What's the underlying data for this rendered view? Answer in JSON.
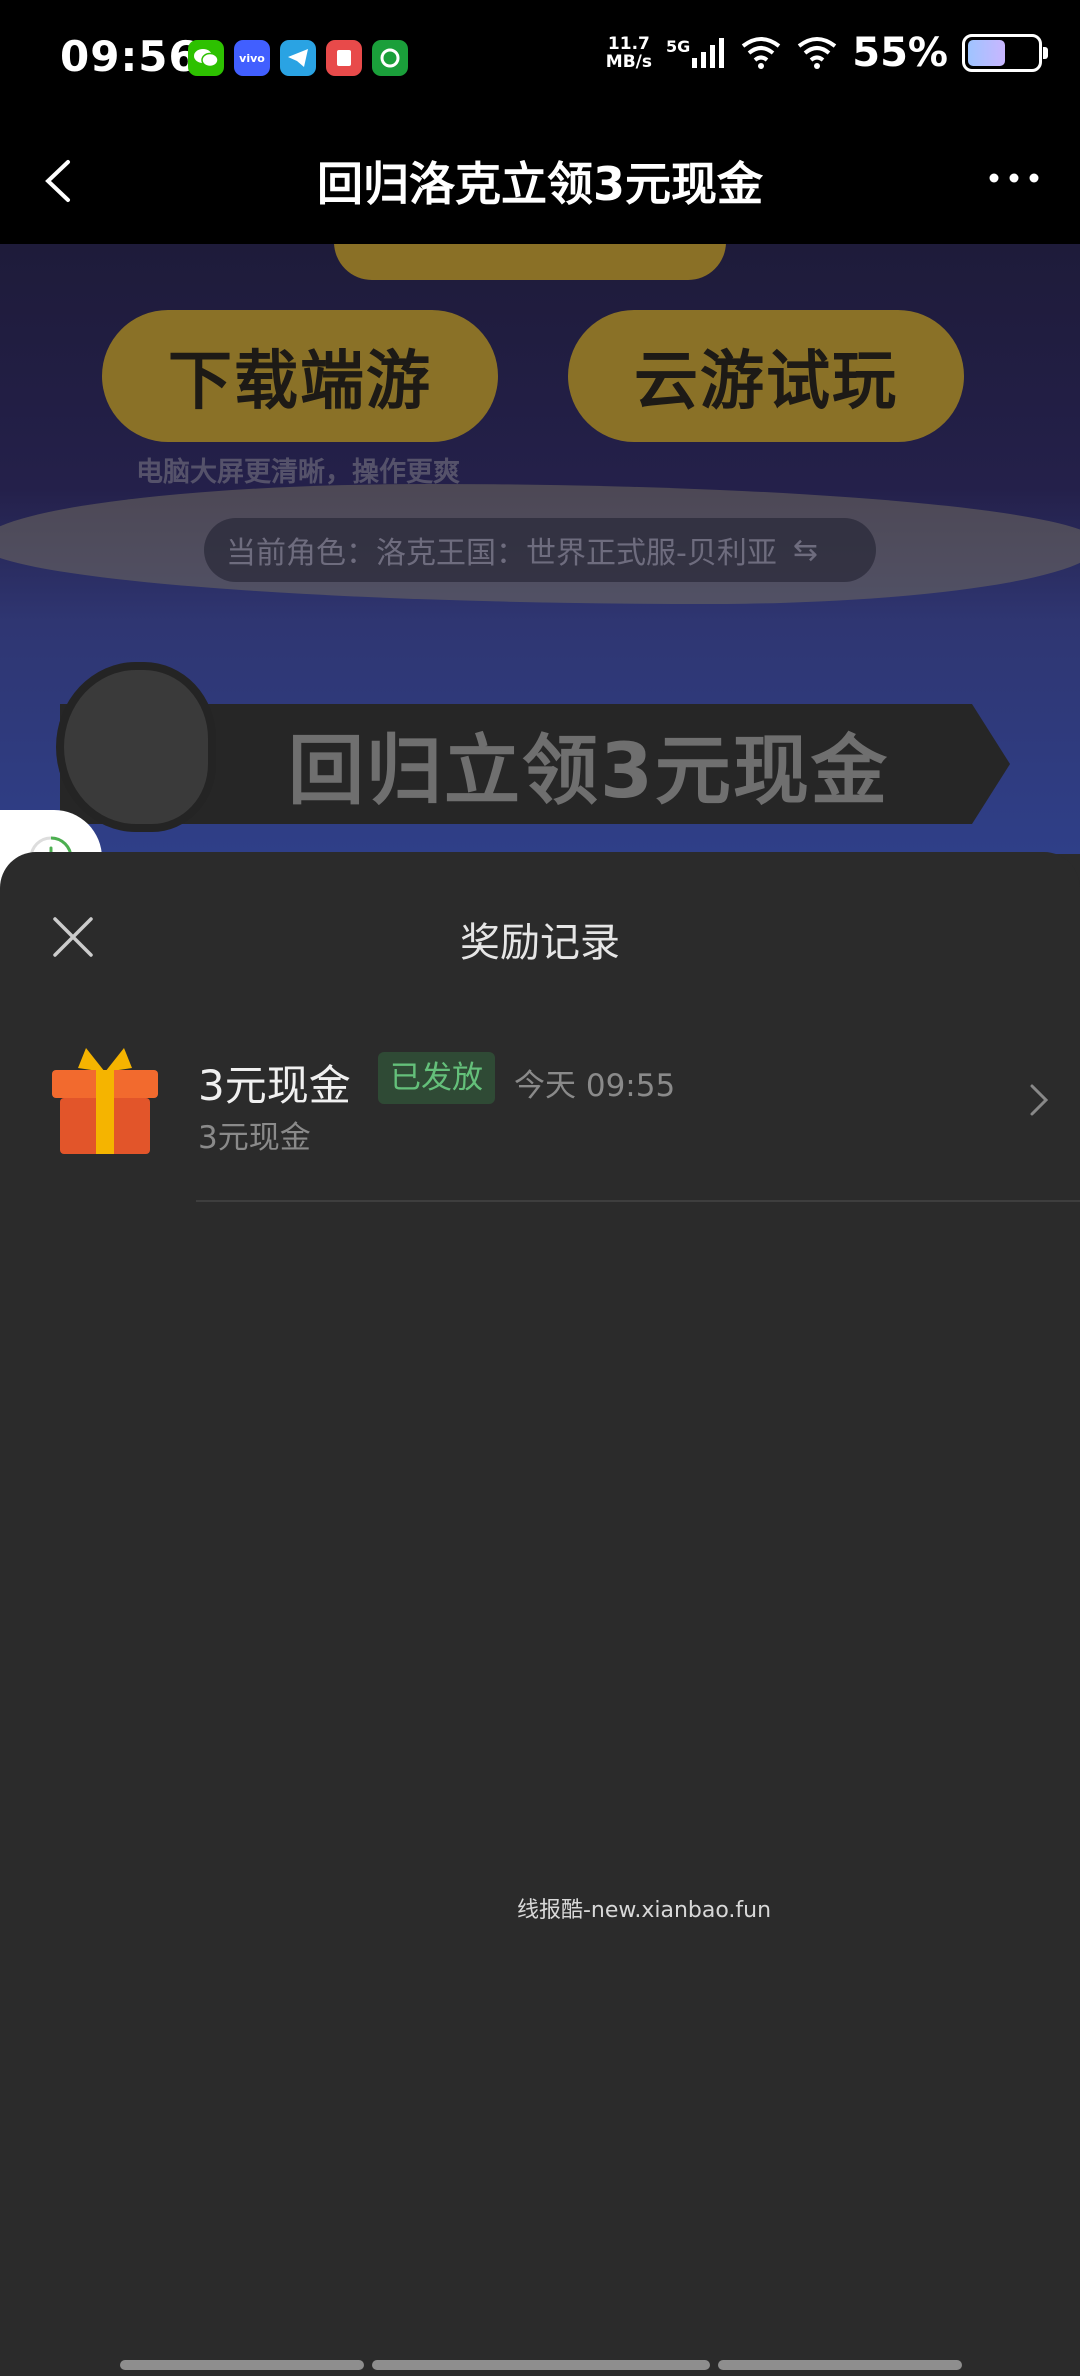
{
  "status_bar": {
    "time": "09:56",
    "net_speed_value": "11.7",
    "net_speed_unit": "MB/s",
    "network": "5G",
    "battery_percent": "55%",
    "battery_level": 0.55,
    "app_icons": [
      "wechat-icon",
      "vivo-icon",
      "telegram-icon",
      "notes-icon",
      "game-app-icon"
    ]
  },
  "header": {
    "title": "回归洛克立领3元现金"
  },
  "background_page": {
    "download_button": "下载端游",
    "cloud_button": "云游试玩",
    "hint": "电脑大屏更清晰，操作更爽",
    "role_label": "当前角色：洛克王国：世界正式服-贝利亚",
    "banner_text": "回归立领3元现金"
  },
  "sheet": {
    "title": "奖励记录",
    "records": [
      {
        "title": "3元现金",
        "badge": "已发放",
        "time": "今天 09:55",
        "subtitle": "3元现金"
      }
    ]
  },
  "watermark": "线报酷-new.xianbao.fun",
  "colors": {
    "sheet_bg": "#2b2b2b",
    "badge_bg": "#2f4a35",
    "badge_text": "#64c07a",
    "gold_button": "#8a7127"
  }
}
